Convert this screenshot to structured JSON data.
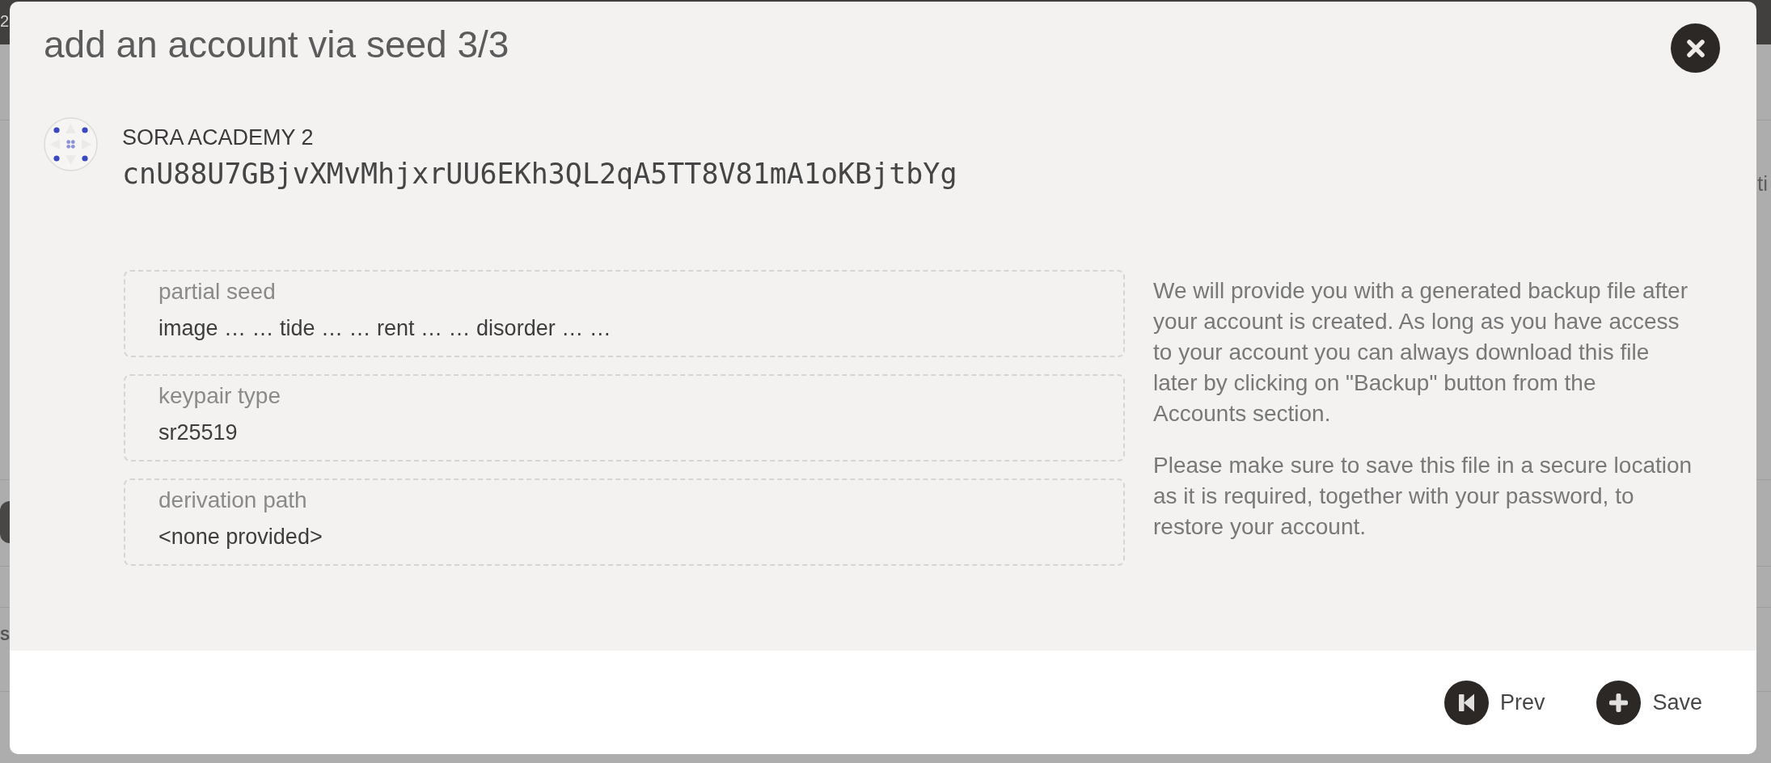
{
  "backdrop": {
    "fragments": [
      {
        "kind": "topbar",
        "text": "2"
      },
      {
        "kind": "right",
        "text": "ti"
      },
      {
        "kind": "left",
        "text": "S"
      }
    ]
  },
  "dialog": {
    "title": "add an account via seed 3/3"
  },
  "account": {
    "name": "SORA ACADEMY 2",
    "address": "cnU88U7GBjvXMvMhjxrUU6EKh3QL2qA5TT8V81mA1oKBjtbYg"
  },
  "fields": [
    {
      "label": "partial seed",
      "value": "image … … tide … … rent … … disorder … …"
    },
    {
      "label": "keypair type",
      "value": "sr25519"
    },
    {
      "label": "derivation path",
      "value": "<none provided>"
    }
  ],
  "info": [
    "We will provide you with a generated backup file after your account is created. As long as you have access to your account you can always download this file later by clicking on \"Backup\" button from the Accounts section.",
    "Please make sure to save this file in a secure location as it is required, together with your password, to restore your account."
  ],
  "buttons": [
    {
      "kind": "prev",
      "label": "Prev"
    },
    {
      "kind": "add",
      "label": "Save"
    }
  ]
}
